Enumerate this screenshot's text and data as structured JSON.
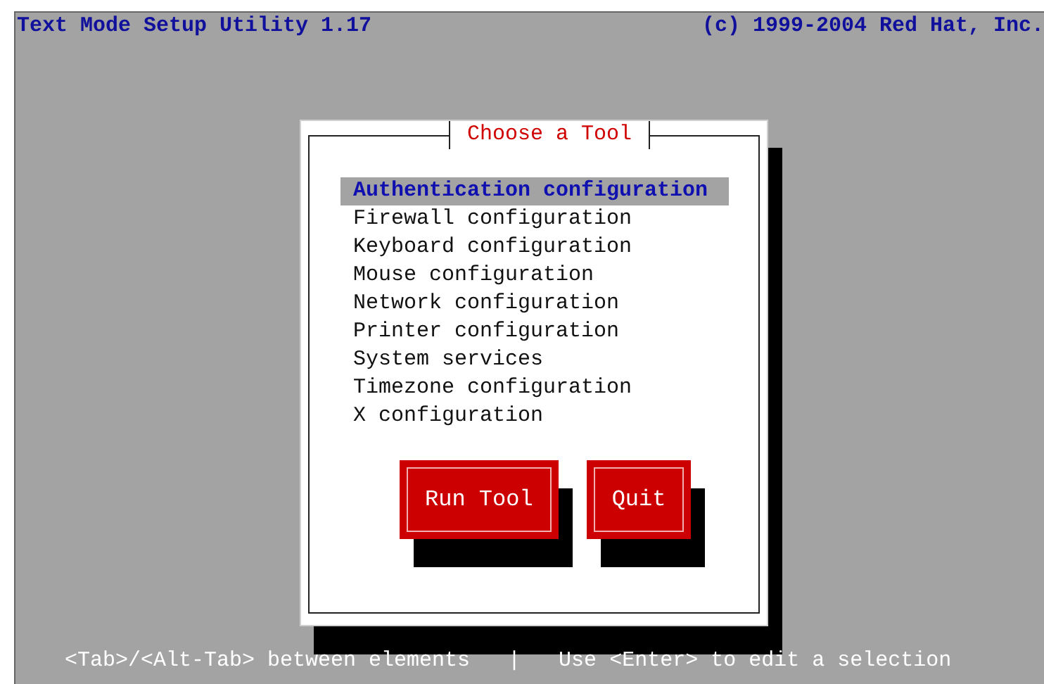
{
  "header": {
    "title": "Text Mode Setup Utility 1.17",
    "copyright": "(c) 1999-2004 Red Hat, Inc."
  },
  "dialog": {
    "title": "Choose a Tool",
    "items": [
      {
        "label": "Authentication configuration",
        "selected": true
      },
      {
        "label": "Firewall configuration",
        "selected": false
      },
      {
        "label": "Keyboard configuration",
        "selected": false
      },
      {
        "label": "Mouse configuration",
        "selected": false
      },
      {
        "label": "Network configuration",
        "selected": false
      },
      {
        "label": "Printer configuration",
        "selected": false
      },
      {
        "label": "System services",
        "selected": false
      },
      {
        "label": "Timezone configuration",
        "selected": false
      },
      {
        "label": "X configuration",
        "selected": false
      }
    ],
    "buttons": [
      "Run Tool",
      "Quit"
    ]
  },
  "help_line": "<Tab>/<Alt-Tab> between elements   |   Use <Enter> to edit a selection"
}
